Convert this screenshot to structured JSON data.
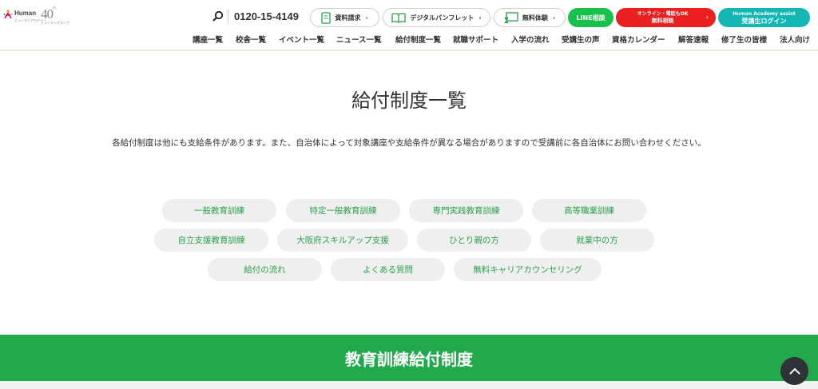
{
  "header": {
    "logo": {
      "brand": "Human",
      "brand_sub": "ヒューマンアカデミー",
      "anniversary": "40",
      "anniversary_suffix": "th",
      "group": "ヒューマングループ"
    },
    "phone": "0120-15-4149",
    "buttons": {
      "document": "資料請求",
      "pamphlet": "デジタルパンフレット",
      "trial": "無料体験",
      "line": "LINE相談",
      "online_top": "オンライン・電話もOK",
      "online_main": "無料相談",
      "login_top": "Human Academy assist",
      "login_main": "受講生ログイン"
    },
    "nav": [
      "講座一覧",
      "校舎一覧",
      "イベント一覧",
      "ニュース一覧",
      "給付制度一覧",
      "就職サポート",
      "入学の流れ",
      "受講生の声",
      "資格カレンダー",
      "解答速報",
      "修了生の皆様",
      "法人向け"
    ],
    "icons": {
      "search": "search-icon",
      "document": "document-icon",
      "pamphlet": "book-icon",
      "trial": "presentation-icon",
      "arrow": "chevron-right-icon"
    }
  },
  "main": {
    "title": "給付制度一覧",
    "description": "各給付制度は他にも支給条件があります。また、自治体によって対象講座や支給条件が異なる場合がありますので受講前に各自治体にお問い合わせください。",
    "chips_row1": [
      "一般教育訓練",
      "特定一般教育訓練",
      "専門実践教育訓練",
      "高等職業訓練"
    ],
    "chips_row2": [
      "自立支援教育訓練",
      "大阪府スキルアップ支援",
      "ひとり親の方",
      "就業中の方"
    ],
    "chips_row3": [
      "給付の流れ",
      "よくある質問",
      "無料キャリアカウンセリング"
    ]
  },
  "section": {
    "title": "教育訓練給付制度"
  },
  "colors": {
    "brand_green": "#22a94c",
    "chip_text": "#2aa24b",
    "line_green": "#17c24b",
    "online_red": "#ea1f1f",
    "login_teal": "#12b7b4"
  }
}
